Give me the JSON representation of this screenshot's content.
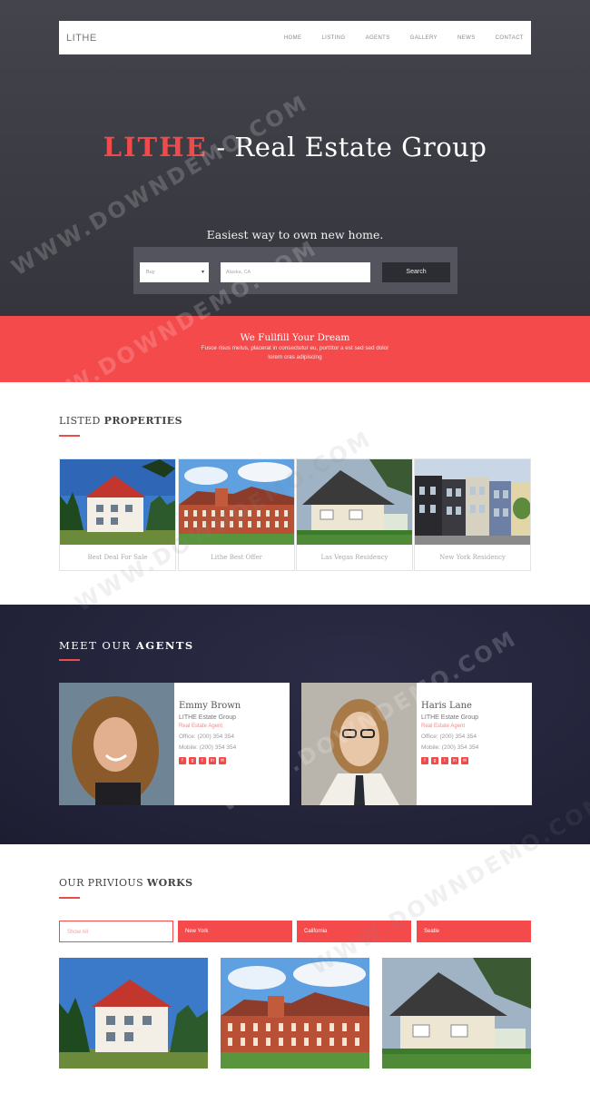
{
  "nav": {
    "logo": "LITHE",
    "items": [
      "HOME",
      "LISTING",
      "AGENTS",
      "GALLERY",
      "NEWS",
      "CONTACT"
    ]
  },
  "hero": {
    "brand": "LITHE",
    "title_rest": " - Real Estate Group",
    "subtitle": "Easiest way to own new home.",
    "search": {
      "select_value": "Buy",
      "location_placeholder": "Alaska, CA",
      "button": "Search"
    }
  },
  "band": {
    "title": "We Fullfill Your Dream",
    "text": "Fusce risus metus, placerat in consectetur eu, porttitor a est sed sed dolor lorem cras adipiscing"
  },
  "listed": {
    "heading_light": "LISTED ",
    "heading_bold": "PROPERTIES",
    "properties": [
      {
        "label": "Best Deal For Sale"
      },
      {
        "label": "Lithe Best Offer"
      },
      {
        "label": "Las Vegas Residency"
      },
      {
        "label": "New York Residency"
      }
    ]
  },
  "agents": {
    "heading_light": "MEET OUR ",
    "heading_bold": "AGENTS",
    "list": [
      {
        "name": "Emmy Brown",
        "company": "LITHE Estate Group",
        "role": "Real Estate Agent",
        "office": "Office: (200) 354 354",
        "mobile": "Mobile: (200) 354 354"
      },
      {
        "name": "Haris Lane",
        "company": "LITHE Estate Group",
        "role": "Real Estate Agent",
        "office": "Office: (200) 354 354",
        "mobile": "Mobile: (200) 354 354"
      }
    ],
    "social_icons": [
      "facebook-icon",
      "google-plus-icon",
      "twitter-icon",
      "linkedin-icon",
      "email-icon"
    ]
  },
  "works": {
    "heading_light": "OUR PRIVIOUS ",
    "heading_bold": "WORKS",
    "filters": [
      "Show All",
      "New York",
      "California",
      "Seatle"
    ]
  },
  "watermark": "WWW.DOWNDEMO.COM",
  "colors": {
    "accent": "#f44a4b",
    "dark": "#23233a",
    "hero": "#3d3d45"
  }
}
